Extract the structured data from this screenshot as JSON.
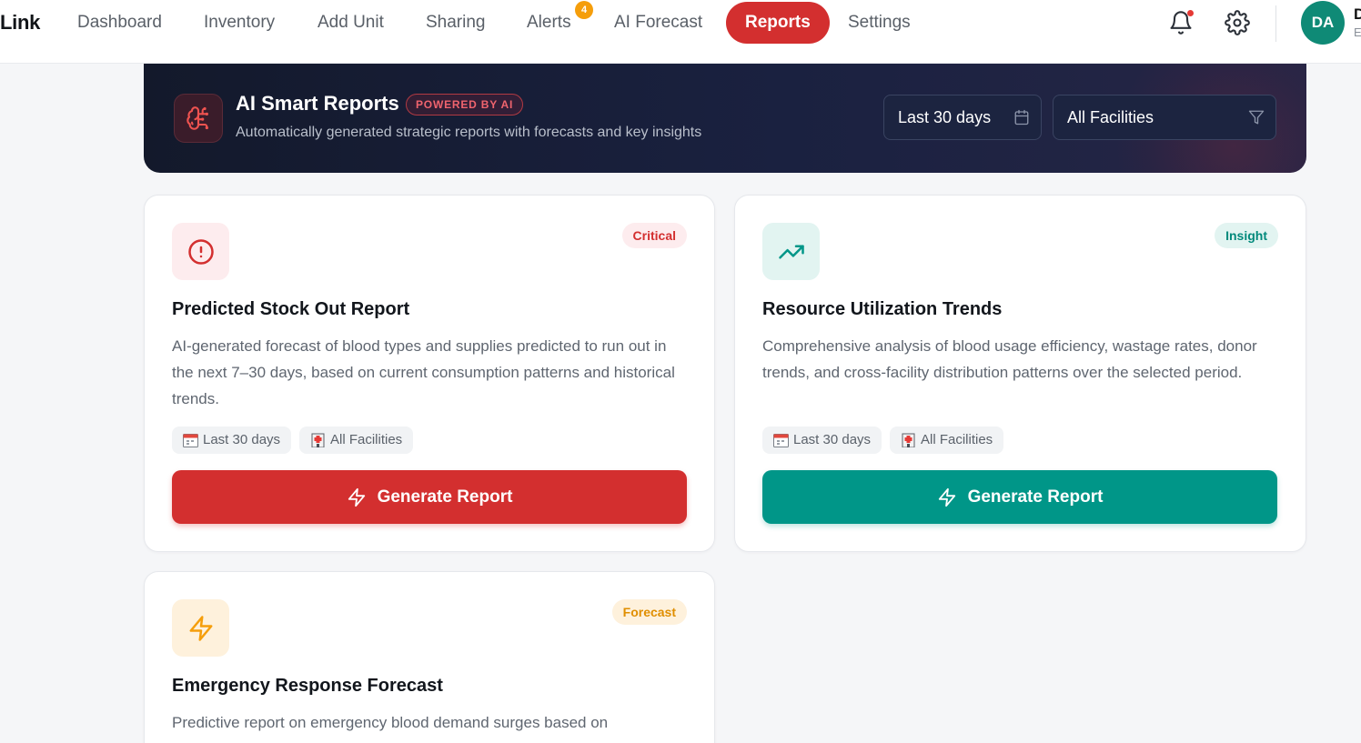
{
  "nav": {
    "brand": "Link",
    "items": [
      {
        "label": "Dashboard"
      },
      {
        "label": "Inventory"
      },
      {
        "label": "Add Unit"
      },
      {
        "label": "Sharing"
      },
      {
        "label": "Alerts",
        "badge": "4"
      },
      {
        "label": "AI Forecast"
      },
      {
        "label": "Reports",
        "active": true
      },
      {
        "label": "Settings"
      }
    ],
    "user": {
      "initials": "DA",
      "name": "D",
      "role": "E"
    },
    "icons": [
      "bell-icon",
      "gear-icon"
    ]
  },
  "hero": {
    "title": "AI Smart Reports",
    "pill": "POWERED BY AI",
    "subtitle": "Automatically generated strategic reports with forecasts and key insights",
    "date_range": "Last 30 days",
    "facility": "All Facilities"
  },
  "cards": [
    {
      "badge": "Critical",
      "title": "Predicted Stock Out Report",
      "description": "AI-generated forecast of blood types and supplies predicted to run out in the next 7–30 days, based on current consumption patterns and historical trends.",
      "chips": [
        "Last 30 days",
        "All Facilities"
      ],
      "button": "Generate Report",
      "accent": "#d32f2f"
    },
    {
      "badge": "Insight",
      "title": "Resource Utilization Trends",
      "description": "Comprehensive analysis of blood usage efficiency, wastage rates, donor trends, and cross-facility distribution patterns over the selected period.",
      "chips": [
        "Last 30 days",
        "All Facilities"
      ],
      "button": "Generate Report",
      "accent": "#009688"
    },
    {
      "badge": "Forecast",
      "title": "Emergency Response Forecast",
      "description": "Predictive report on emergency blood demand surges based on",
      "accent": "#f59e0b"
    }
  ]
}
